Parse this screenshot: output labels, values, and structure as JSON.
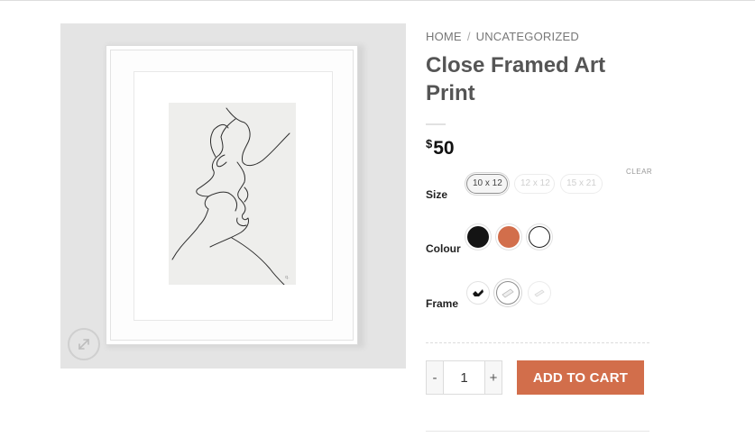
{
  "breadcrumb": {
    "home": "HOME",
    "separator": "/",
    "category": "UNCATEGORIZED"
  },
  "product": {
    "title": "Close Framed Art Print",
    "price_currency": "$",
    "price_value": "50"
  },
  "variations": {
    "size": {
      "label": "Size",
      "options": [
        {
          "label": "10 x 12",
          "state": "selected"
        },
        {
          "label": "12 x 12",
          "state": "disabled"
        },
        {
          "label": "15 x 21",
          "state": "disabled"
        }
      ],
      "clear_label": "CLEAR"
    },
    "colour": {
      "label": "Colour",
      "options": [
        {
          "name": "black",
          "color": "#141414"
        },
        {
          "name": "orange",
          "color": "#d26e4b"
        },
        {
          "name": "white",
          "color": "#ffffff"
        }
      ]
    },
    "frame": {
      "label": "Frame",
      "options": [
        {
          "name": "black-frame-icon",
          "state": "available"
        },
        {
          "name": "white-frame-icon",
          "state": "selected"
        },
        {
          "name": "light-frame-icon",
          "state": "disabled"
        }
      ]
    }
  },
  "cart": {
    "minus_label": "-",
    "quantity": "1",
    "plus_label": "+",
    "add_to_cart_label": "ADD TO CART"
  },
  "colors": {
    "accent": "#d26e4b",
    "text": "#555555",
    "price": "#111111"
  },
  "icons": {
    "zoom": "expand-icon"
  }
}
